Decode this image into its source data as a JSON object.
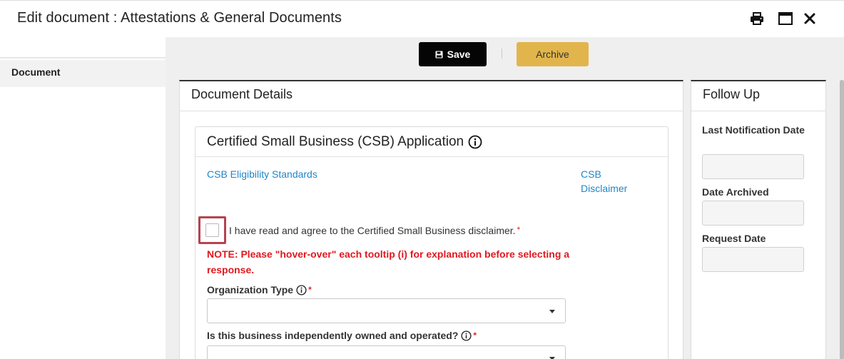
{
  "window": {
    "title": "Edit document : Attestations & General Documents"
  },
  "leftnav": {
    "items": [
      {
        "label": "Document"
      }
    ]
  },
  "toolbar": {
    "save_label": "Save",
    "archive_label": "Archive"
  },
  "details": {
    "title": "Document Details",
    "section": {
      "title": "Certified Small Business (CSB) Application",
      "links": [
        "CSB Eligibility Standards",
        "CSB Disclaimer"
      ],
      "checkbox_label": "I have read and agree to the Certified Small Business disclaimer.",
      "required_mark": "*",
      "note": "NOTE:  Please \"hover-over\" each tooltip (i) for explanation before selecting a response.",
      "fields": [
        {
          "label": "Organization Type",
          "value": ""
        },
        {
          "label": "Is this business independently owned and operated?",
          "value": ""
        }
      ]
    }
  },
  "followup": {
    "title": "Follow Up",
    "fields": [
      {
        "label": "Last Notification Date",
        "value": ""
      },
      {
        "label": "Date Archived",
        "value": ""
      },
      {
        "label": "Request Date",
        "value": ""
      }
    ]
  },
  "colors": {
    "save_bg": "#050505",
    "archive_bg": "#e2b54c",
    "link": "#1f86c9",
    "note": "#e0191f",
    "highlight": "#b5434f"
  }
}
